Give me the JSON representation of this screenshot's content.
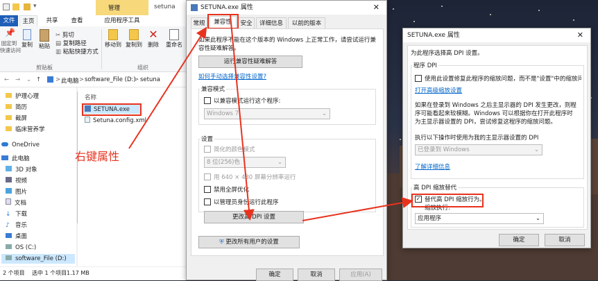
{
  "explorer": {
    "ribbon_tabs": {
      "file": "文件",
      "home": "主页",
      "share": "共享",
      "view": "查看",
      "manage_header": "管理",
      "app_tools": "应用程序工具",
      "window_title": "setuna"
    },
    "ribbon": {
      "pin": "固定到\n快速访问",
      "copy": "复制",
      "paste": "粘贴",
      "cut": "剪切",
      "copy_path": "复制路径",
      "paste_shortcut": "粘贴快捷方式",
      "clipboard_group": "剪贴板",
      "move_to": "移动到",
      "copy_to": "复制到",
      "delete": "删除",
      "rename": "重命名",
      "organize_group": "组织"
    },
    "address": {
      "parts": [
        "此电脑",
        "software_File (D:)",
        "setuna"
      ],
      "sep": ">"
    },
    "nav": [
      {
        "label": "护理心理",
        "icon": "folder-icon"
      },
      {
        "label": "简历",
        "icon": "folder-icon"
      },
      {
        "label": "截屏",
        "icon": "folder-icon"
      },
      {
        "label": "临床营养学",
        "icon": "folder-icon"
      },
      {
        "label": "OneDrive",
        "icon": "cloud-icon"
      },
      {
        "label": "此电脑",
        "icon": "computer-icon"
      },
      {
        "label": "3D 对象",
        "icon": "cube-icon"
      },
      {
        "label": "视频",
        "icon": "video-icon"
      },
      {
        "label": "图片",
        "icon": "picture-icon"
      },
      {
        "label": "文档",
        "icon": "document-icon"
      },
      {
        "label": "下载",
        "icon": "download-icon"
      },
      {
        "label": "音乐",
        "icon": "music-icon"
      },
      {
        "label": "桌面",
        "icon": "desktop-icon"
      },
      {
        "label": "OS (C:)",
        "icon": "drive-icon"
      },
      {
        "label": "software_File (D:)",
        "icon": "drive-icon"
      }
    ],
    "column_name": "名称",
    "files": [
      {
        "name": "SETUNA.exe"
      },
      {
        "name": "Setuna.config.xml"
      }
    ],
    "annotation": "右键属性",
    "status": {
      "count": "个项目",
      "selected": "选中 1 个项目",
      "size": "1.17 MB"
    }
  },
  "props1": {
    "title": "SETUNA.exe 属性",
    "tabs": [
      "常规",
      "兼容性",
      "安全",
      "详细信息",
      "以前的版本"
    ],
    "intro": "如果此程序不能在这个版本的 Windows 上正常工作，请尝试运行兼容性疑难解答。",
    "troubleshoot_button": "运行兼容性疑难解答",
    "manual_link": "如何手动选择兼容性设置?",
    "compat_mode_group": "兼容模式",
    "compat_mode_check": "以兼容模式运行这个程序:",
    "compat_os": "Windows 7",
    "settings_group": "设置",
    "reduced_color": "简化的颜色模式",
    "color_value": "8 位(256)色",
    "res_640": "用 640 × 480 屏幕分辨率运行",
    "disable_fullscreen": "禁用全屏优化",
    "run_admin": "以管理员身份运行此程序",
    "change_dpi_button": "更改高 DPI 设置",
    "all_users_button": "更改所有用户的设置",
    "ok": "确定",
    "cancel": "取消",
    "apply": "应用(A)"
  },
  "props2": {
    "title": "SETUNA.exe 属性",
    "heading": "为此程序选择高 DPI 设置。",
    "program_dpi_group": "程序 DPI",
    "program_dpi_check": "使用此设置修复此程序的缩放问题，而不是\"设置\"中的缩放问题",
    "open_scaling_link": "打开高级缩放设置",
    "explain": "如果在登录到 Windows 之后主显示器的 DPI 发生更改，则程序可能看起来较模糊。Windows 可以根据你在打开此程序时为主显示器设置的 DPI，尝试修复这程序的缩放问题。",
    "use_dpi_label": "执行以下操作时使用为我的主显示器设置的 DPI",
    "use_dpi_value": "已登录到 Windows",
    "learn_more": "了解详细信息",
    "override_group": "高 DPI 缩放替代",
    "override_check": "替代高 DPI 缩放行为。",
    "scaling_by": "缩放执行:",
    "scaling_value": "应用程序",
    "ok": "确定",
    "cancel": "取消"
  },
  "colors": {
    "accent": "#e8321e",
    "link": "#0066cc",
    "selection": "#cce8ff",
    "ribbon_accent": "#1e5eb8"
  }
}
